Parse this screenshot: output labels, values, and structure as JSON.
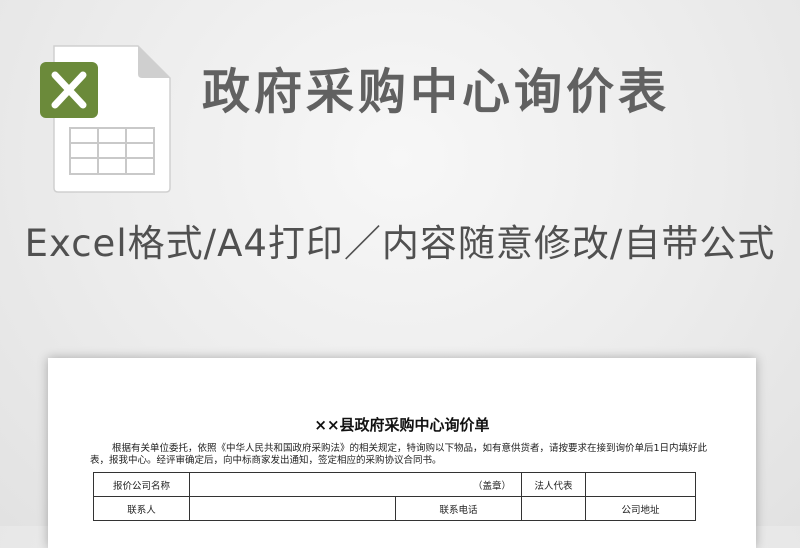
{
  "header": {
    "title": "政府采购中心询价表",
    "subtitle": "Excel格式/A4打印／内容随意修改/自带公式",
    "icon": "excel-file-icon",
    "accent_color": "#6b8a3a"
  },
  "document": {
    "title": "××县政府采购中心询价单",
    "intro": "根据有关单位委托，依照《中华人民共和国政府采购法》的相关规定，特询购以下物品，如有意供货者，请按要求在接到询价单后1日内填好此表，报我中心。经评审确定后，向中标商家发出通知，签定相应的采购协议合同书。",
    "form": {
      "company_label": "报价公司名称",
      "seal_label": "（盖章）",
      "legal_rep_label": "法人代表",
      "contact_label": "联系人",
      "phone_label": "联系电话",
      "address_label": "公司地址"
    }
  }
}
